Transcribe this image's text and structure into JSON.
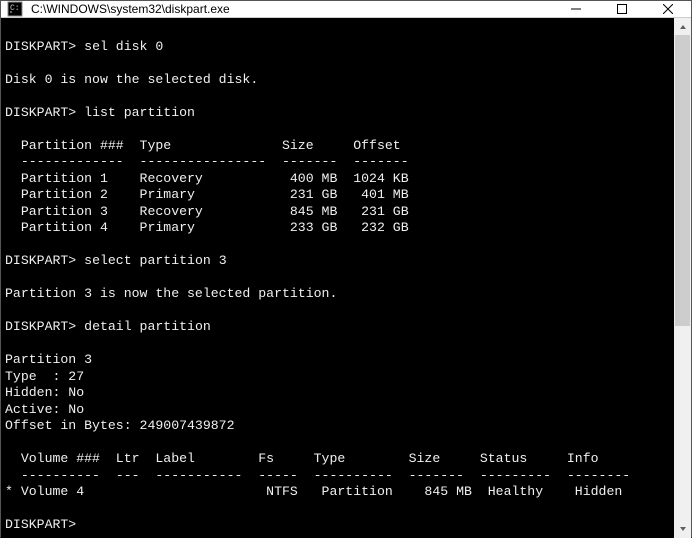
{
  "window": {
    "title": "C:\\WINDOWS\\system32\\diskpart.exe"
  },
  "session": {
    "prompt": "DISKPART>",
    "cmd1": "sel disk 0",
    "resp1": "Disk 0 is now the selected disk.",
    "cmd2": "list partition",
    "part_header": "  Partition ###  Type              Size     Offset",
    "part_divider": "  -------------  ----------------  -------  -------",
    "part1": "  Partition 1    Recovery           400 MB  1024 KB",
    "part2": "  Partition 2    Primary            231 GB   401 MB",
    "part3": "  Partition 3    Recovery           845 MB   231 GB",
    "part4": "  Partition 4    Primary            233 GB   232 GB",
    "cmd3": "select partition 3",
    "resp3": "Partition 3 is now the selected partition.",
    "cmd4": "detail partition",
    "det1": "Partition 3",
    "det2": "Type  : 27",
    "det3": "Hidden: No",
    "det4": "Active: No",
    "det5": "Offset in Bytes: 249007439872",
    "vol_header": "  Volume ###  Ltr  Label        Fs     Type        Size     Status     Info",
    "vol_divider": "  ----------  ---  -----------  -----  ----------  -------  ---------  --------",
    "vol_row": "* Volume 4                       NTFS   Partition    845 MB  Healthy    Hidden"
  }
}
